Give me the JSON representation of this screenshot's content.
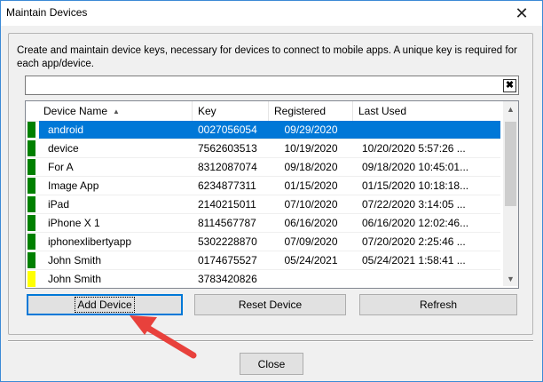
{
  "window": {
    "title": "Maintain Devices",
    "close_glyph": "✕"
  },
  "description": "Create and maintain device keys, necessary for devices to connect to mobile apps.  A unique key is required for each app/device.",
  "search": {
    "value": "",
    "placeholder": "",
    "clear_glyph": "✖"
  },
  "table": {
    "columns": [
      "Device Name",
      "Key",
      "Registered",
      "Last Used"
    ],
    "sorted_column": "Device Name",
    "sort_glyph": "▲",
    "rows": [
      {
        "name": "android",
        "key": "0027056054",
        "registered": "09/29/2020",
        "last_used": "",
        "status_color": "#008000",
        "selected": true
      },
      {
        "name": "device",
        "key": "7562603513",
        "registered": "10/19/2020",
        "last_used": "10/20/2020 5:57:26 ...",
        "status_color": "#008000",
        "selected": false
      },
      {
        "name": "For A",
        "key": "8312087074",
        "registered": "09/18/2020",
        "last_used": "09/18/2020 10:45:01...",
        "status_color": "#008000",
        "selected": false
      },
      {
        "name": "Image App",
        "key": "6234877311",
        "registered": "01/15/2020",
        "last_used": "01/15/2020 10:18:18...",
        "status_color": "#008000",
        "selected": false
      },
      {
        "name": "iPad",
        "key": "2140215011",
        "registered": "07/10/2020",
        "last_used": "07/22/2020 3:14:05 ...",
        "status_color": "#008000",
        "selected": false
      },
      {
        "name": "iPhone X 1",
        "key": "8114567787",
        "registered": "06/16/2020",
        "last_used": "06/16/2020 12:02:46...",
        "status_color": "#008000",
        "selected": false
      },
      {
        "name": "iphonexlibertyapp",
        "key": "5302228870",
        "registered": "07/09/2020",
        "last_used": "07/20/2020 2:25:46 ...",
        "status_color": "#008000",
        "selected": false
      },
      {
        "name": "John Smith",
        "key": "0174675527",
        "registered": "05/24/2021",
        "last_used": "05/24/2021 1:58:41 ...",
        "status_color": "#008000",
        "selected": false
      },
      {
        "name": "John Smith",
        "key": "3783420826",
        "registered": "",
        "last_used": "",
        "status_color": "#ffff00",
        "selected": false
      }
    ],
    "scroll_up_glyph": "▲",
    "scroll_down_glyph": "▼"
  },
  "buttons": {
    "add": "Add Device",
    "reset": "Reset Device",
    "refresh": "Refresh",
    "close": "Close"
  },
  "colors": {
    "selection": "#0078d7",
    "annotation_arrow": "#e8413c"
  }
}
